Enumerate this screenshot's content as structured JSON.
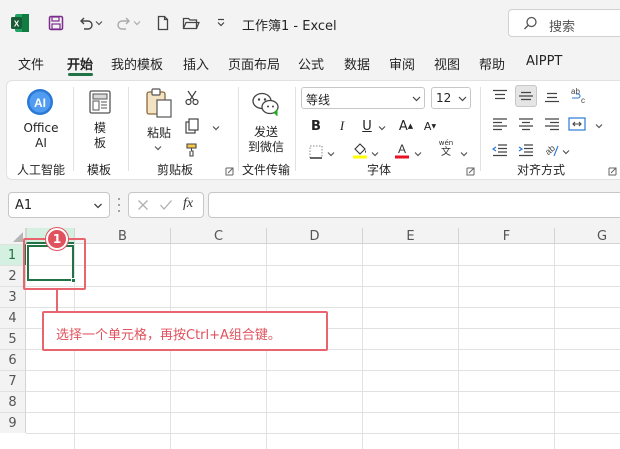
{
  "app": {
    "title": "工作簿1  -  Excel",
    "search_placeholder": "搜索",
    "brand_color": "#217346"
  },
  "quick_access": {
    "icons": [
      "excel-logo-icon",
      "save-icon",
      "undo-icon",
      "redo-icon",
      "new-file-icon",
      "open-folder-icon",
      "customize-dropdown-icon"
    ]
  },
  "menu": {
    "tabs": [
      "文件",
      "开始",
      "我的模板",
      "插入",
      "页面布局",
      "公式",
      "数据",
      "审阅",
      "视图",
      "帮助",
      "AIPPT"
    ],
    "active": "开始"
  },
  "ribbon": {
    "ai_group": {
      "button_line1": "Office",
      "button_line2": "AI",
      "label": "人工智能"
    },
    "template_group": {
      "button_line1": "模",
      "button_line2": "板",
      "label": "模板"
    },
    "clipboard_group": {
      "paste_label": "粘贴",
      "label": "剪贴板"
    },
    "transfer_group": {
      "button_line1": "发送",
      "button_line2": "到微信",
      "label": "文件传输"
    },
    "font_group": {
      "font_name": "等线",
      "font_size": "12",
      "label": "字体",
      "bold": "B",
      "italic": "I",
      "underline": "U",
      "grow": "A",
      "shrink": "A",
      "phonetic_top": "wén",
      "phonetic_bottom": "文"
    },
    "align_group": {
      "label": "对齐方式"
    }
  },
  "formula_bar": {
    "name_box": "A1",
    "fx": "fx",
    "formula": ""
  },
  "sheet": {
    "columns": [
      "A",
      "B",
      "C",
      "D",
      "E",
      "F",
      "G"
    ],
    "rows": [
      "1",
      "2",
      "3",
      "4",
      "5",
      "6",
      "7",
      "8",
      "9"
    ],
    "selected_cell": "A1"
  },
  "annotation": {
    "step_number": "1",
    "text": "选择一个单元格，再按Ctrl+A组合键。",
    "color": "#e0525d"
  }
}
